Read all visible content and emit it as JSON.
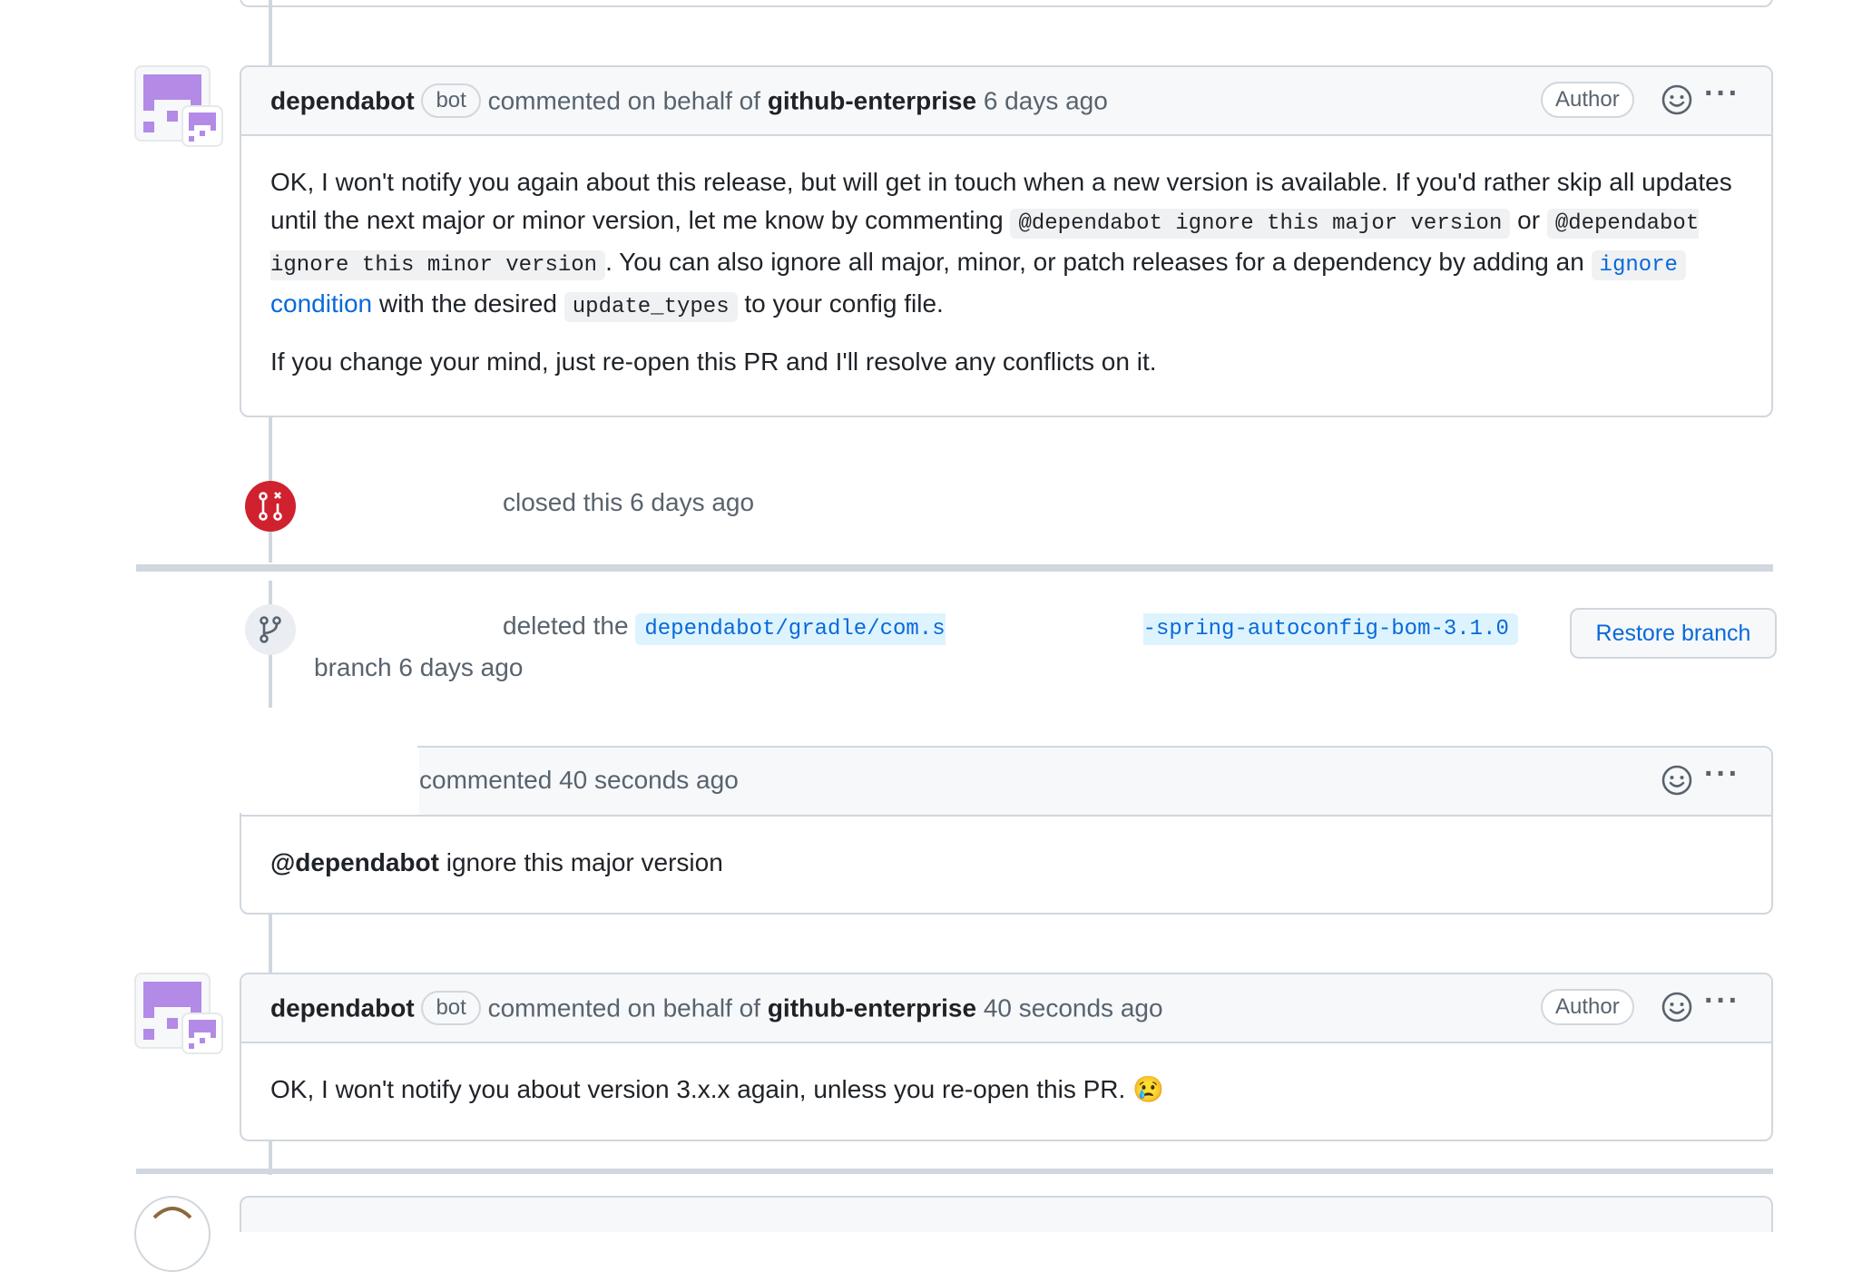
{
  "comment1": {
    "author": "dependabot",
    "bot_label": "bot",
    "action": "commented on behalf of",
    "org": "github-enterprise",
    "time": "6 days ago",
    "role": "Author",
    "body_p1_a": "OK, I won't notify you again about this release, but will get in touch when a new version is available. If you'd rather skip all updates until the next major or minor version, let me know by commenting",
    "code_major": "@dependabot ignore this major version",
    "or_text": "or",
    "code_minor": "@dependabot ignore this minor version",
    "body_p1_b": ". You can also ignore all major, minor, or patch releases for a dependency by adding an",
    "link_code": "ignore",
    "link_text": "condition",
    "body_p1_c": "with the desired",
    "code_update": "update_types",
    "body_p1_d": "to your config file.",
    "body_p2": "If you change your mind, just re-open this PR and I'll resolve any conflicts on it."
  },
  "closed_event": {
    "text": "closed this 6 days ago"
  },
  "deleted_event": {
    "prefix": "deleted the",
    "branch_start": "dependabot/gradle/com.s",
    "branch_end": "-spring-autoconfig-bom-3.1.0",
    "suffix": "branch 6 days ago",
    "restore_label": "Restore branch"
  },
  "comment2": {
    "time_text": "commented 40 seconds ago",
    "mention": "@dependabot",
    "body": "ignore this major version"
  },
  "comment3": {
    "author": "dependabot",
    "bot_label": "bot",
    "action": "commented on behalf of",
    "org": "github-enterprise",
    "time": "40 seconds ago",
    "role": "Author",
    "body": "OK, I won't notify you about version 3.x.x again, unless you re-open this PR.",
    "emoji": "😢"
  },
  "colors": {
    "closed_red": "#cf222e",
    "link_blue": "#0969da",
    "avatar_purple": "#b38ae6"
  }
}
